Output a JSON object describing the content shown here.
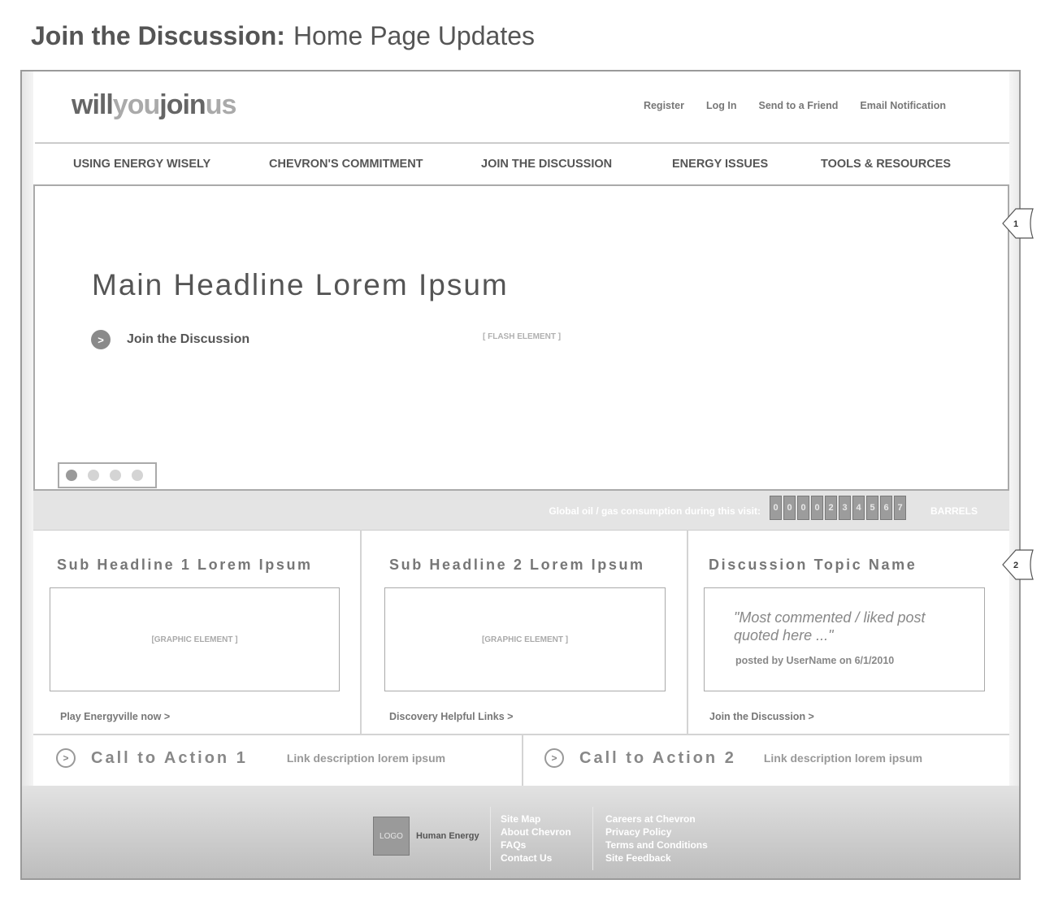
{
  "heading": {
    "bold": "Join the Discussion:",
    "normal": "Home Page Updates"
  },
  "logo": {
    "part1": "will",
    "part2": "you",
    "part3": "join",
    "part4": "us"
  },
  "utility_nav": [
    "Register",
    "Log In",
    "Send to a Friend",
    "Email Notification"
  ],
  "main_nav": [
    "USING ENERGY WISELY",
    "CHEVRON'S COMMITMENT",
    "JOIN THE DISCUSSION",
    "ENERGY ISSUES",
    "TOOLS & RESOURCES"
  ],
  "hero": {
    "headline": "Main Headline Lorem Ipsum",
    "cta_label": "Join the Discussion",
    "cta_arrow": ">",
    "flash_label": "[ FLASH ELEMENT ]",
    "slides_count": 4,
    "active_slide": 1
  },
  "counter": {
    "label": "Global oil / gas consumption during this visit:",
    "digits": [
      "0",
      "0",
      "0",
      "0",
      "2",
      "3",
      "4",
      "5",
      "6",
      "7"
    ],
    "unit": "BARRELS"
  },
  "columns": [
    {
      "title": "Sub Headline 1 Lorem Ipsum",
      "graphic": "[GRAPHIC ELEMENT ]",
      "link": "Play Energyville now >"
    },
    {
      "title": "Sub Headline 2 Lorem Ipsum",
      "graphic": "[GRAPHIC ELEMENT ]",
      "link": "Discovery Helpful Links >"
    },
    {
      "title": "Discussion Topic Name",
      "quote": "\"Most commented / liked post quoted here ...\"",
      "posted": "posted by UserName on 6/1/2010",
      "link": "Join the Discussion >"
    }
  ],
  "ctas": [
    {
      "arrow": ">",
      "title": "Call to Action 1",
      "desc": "Link description lorem ipsum"
    },
    {
      "arrow": ">",
      "title": "Call to Action 2",
      "desc": "Link description lorem ipsum"
    }
  ],
  "footer": {
    "logo": "LOGO",
    "tagline": "Human Energy",
    "links_col1": [
      "Site Map",
      "About Chevron",
      "FAQs",
      "Contact Us"
    ],
    "links_col2": [
      "Careers at Chevron",
      "Privacy Policy",
      "Terms and Conditions",
      "Site Feedback"
    ]
  },
  "annotations": [
    "1",
    "2"
  ]
}
